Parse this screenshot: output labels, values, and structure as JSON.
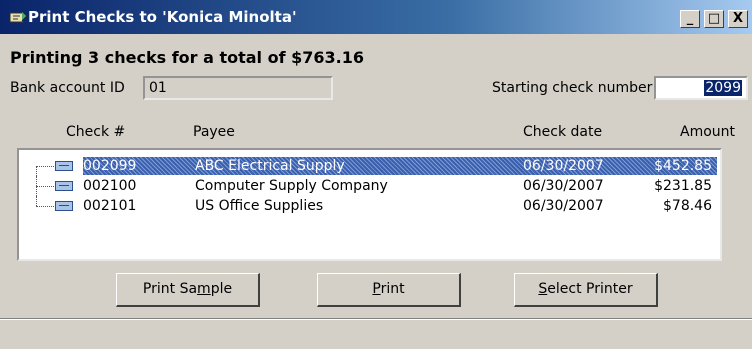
{
  "window": {
    "title": "Print Checks to 'Konica Minolta'",
    "controls": {
      "minimize": "_",
      "maximize": "□",
      "close": "X"
    }
  },
  "summary": "Printing 3 checks for a total of $763.16",
  "bank_account": {
    "label": "Bank account ID",
    "value": "01"
  },
  "starting_check": {
    "label": "Starting check number",
    "value": "2099"
  },
  "columns": {
    "check": "Check #",
    "payee": "Payee",
    "date": "Check date",
    "amount": "Amount"
  },
  "checks": [
    {
      "number": "002099",
      "payee": "ABC Electrical Supply",
      "date": "06/30/2007",
      "amount": "$452.85",
      "selected": true
    },
    {
      "number": "002100",
      "payee": "Computer Supply Company",
      "date": "06/30/2007",
      "amount": "$231.85"
    },
    {
      "number": "002101",
      "payee": "US Office Supplies",
      "date": "06/30/2007",
      "amount": "$78.46"
    }
  ],
  "buttons": {
    "print_sample": {
      "pre": "Print Sa",
      "key": "m",
      "post": "ple"
    },
    "print": {
      "pre": "",
      "key": "P",
      "post": "rint"
    },
    "select_printer": {
      "pre": "",
      "key": "S",
      "post": "elect Printer"
    }
  },
  "colors": {
    "title_start": "#0a246a",
    "title_end": "#a6caf0",
    "selection": "#3a5fad",
    "face": "#d4d0c8"
  },
  "icons": [
    "app-icon",
    "check-document-icon"
  ]
}
